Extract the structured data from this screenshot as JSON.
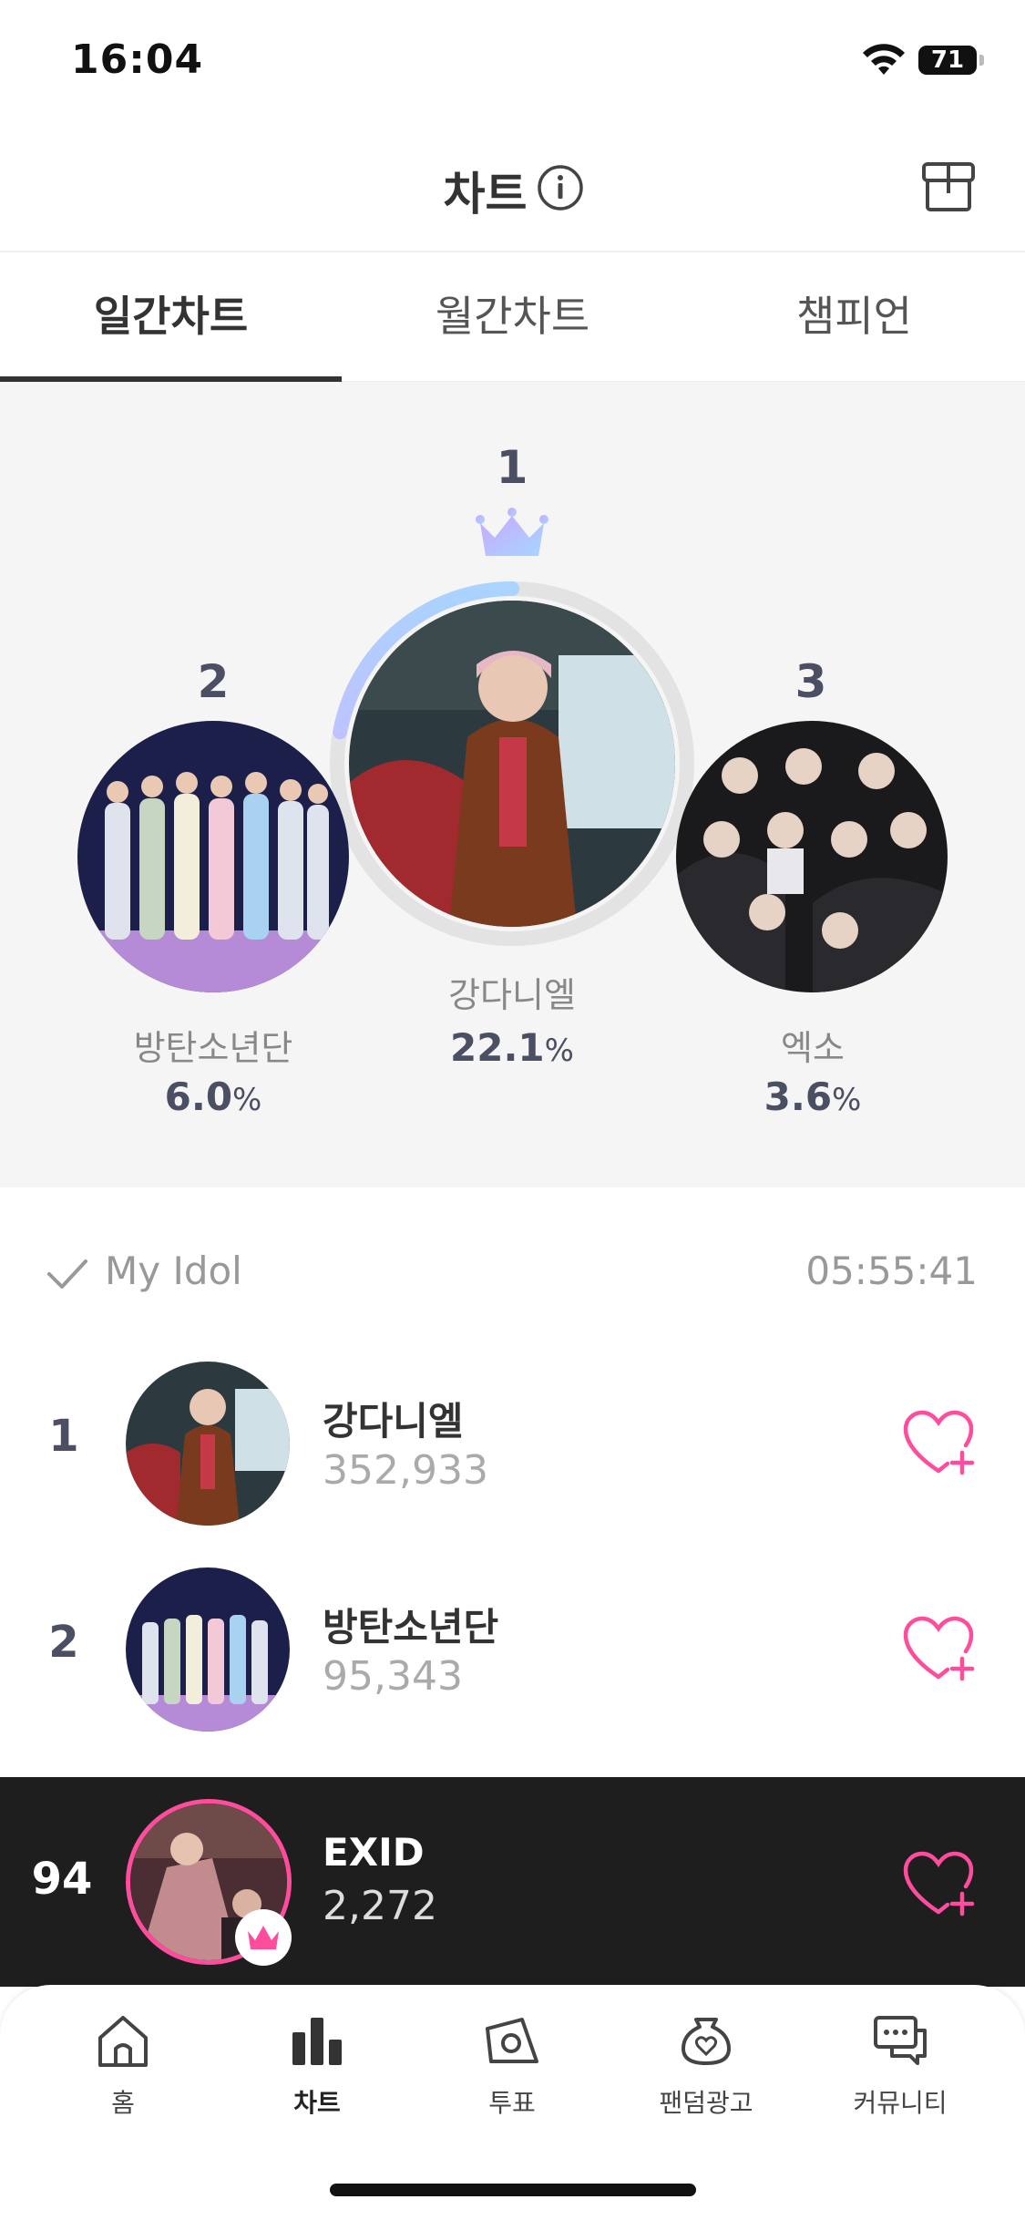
{
  "status": {
    "time": "16:04",
    "battery": "71"
  },
  "header": {
    "title": "차트"
  },
  "tabs": [
    {
      "label": "일간차트",
      "active": true
    },
    {
      "label": "월간차트",
      "active": false
    },
    {
      "label": "챔피언",
      "active": false
    }
  ],
  "podium": {
    "first": {
      "rank": "1",
      "name": "강다니엘",
      "percent": "22.1",
      "unit": "%"
    },
    "second": {
      "rank": "2",
      "name": "방탄소년단",
      "percent": "6.0",
      "unit": "%"
    },
    "third": {
      "rank": "3",
      "name": "엑소",
      "percent": "3.6",
      "unit": "%"
    }
  },
  "list_header": {
    "filter_label": "My Idol",
    "countdown": "05:55:41"
  },
  "rows": [
    {
      "rank": "1",
      "name": "강다니엘",
      "votes": "352,933"
    },
    {
      "rank": "2",
      "name": "방탄소년단",
      "votes": "95,343"
    }
  ],
  "my_idol_row": {
    "rank": "94",
    "name": "EXID",
    "votes": "2,272"
  },
  "bottom_nav": [
    {
      "label": "홈",
      "icon": "home-icon",
      "active": false
    },
    {
      "label": "차트",
      "icon": "chart-icon",
      "active": true
    },
    {
      "label": "투표",
      "icon": "vote-icon",
      "active": false
    },
    {
      "label": "팬덤광고",
      "icon": "fandom-ad-icon",
      "active": false
    },
    {
      "label": "커뮤니티",
      "icon": "community-icon",
      "active": false
    }
  ],
  "colors": {
    "accent_pink": "#ff4d9d",
    "rank_text": "#4b4f63",
    "crown_gradient_start": "#c9a8ff",
    "crown_gradient_end": "#a6d6ff"
  }
}
